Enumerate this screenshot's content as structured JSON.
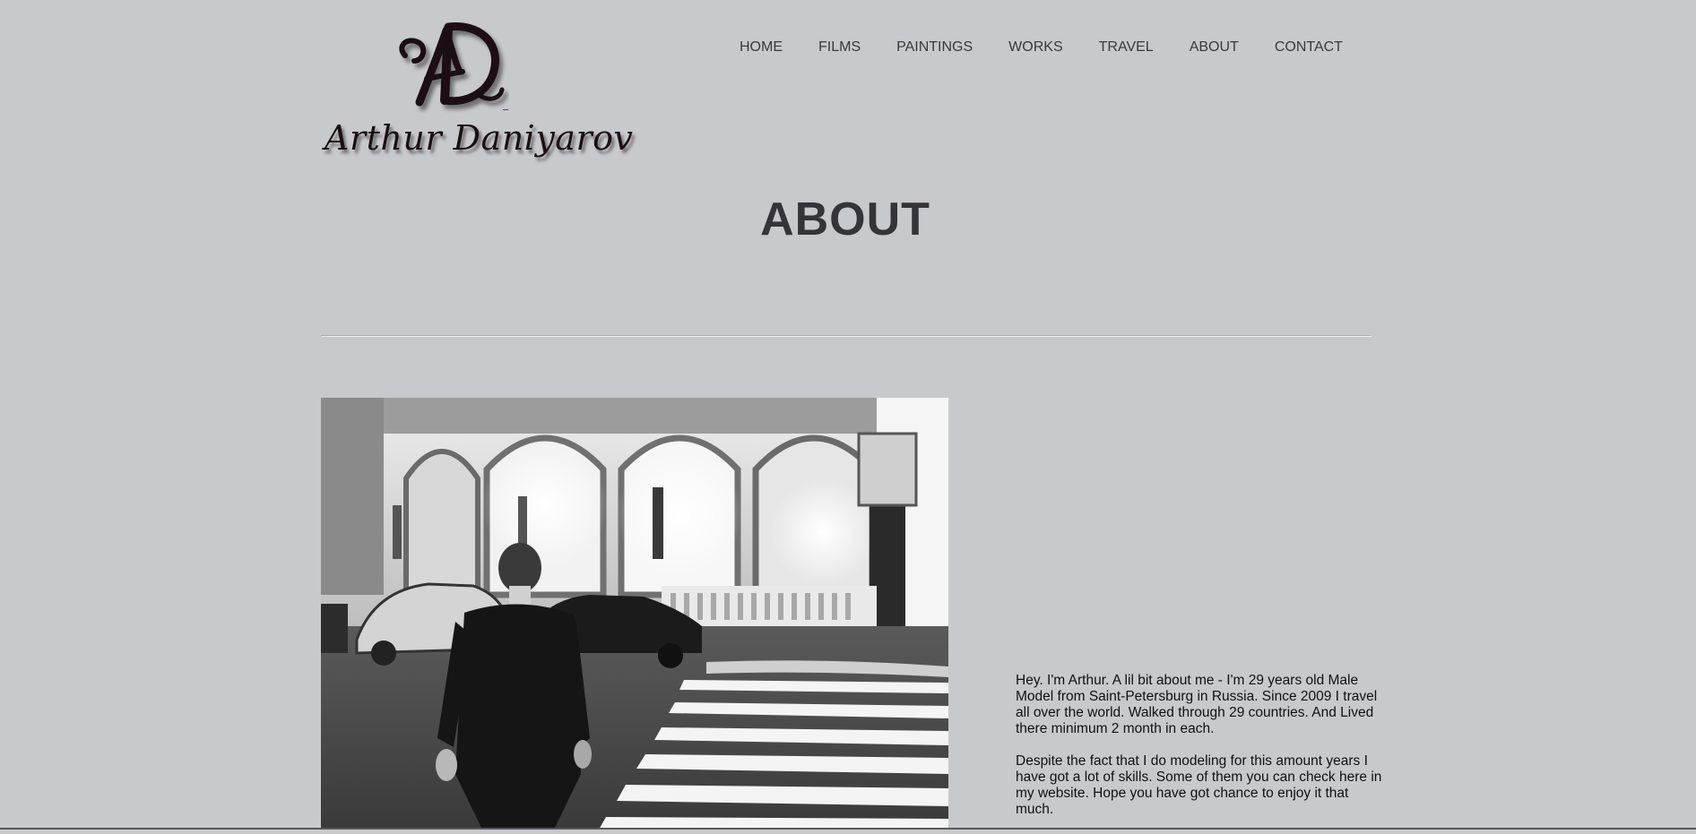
{
  "site": {
    "brand_name": "Arthur Daniyarov",
    "monogram": "AD"
  },
  "nav": {
    "items": [
      {
        "label": "HOME"
      },
      {
        "label": "FILMS"
      },
      {
        "label": "PAINTINGS"
      },
      {
        "label": "WORKS"
      },
      {
        "label": "TRAVEL"
      },
      {
        "label": "ABOUT"
      },
      {
        "label": "CONTACT"
      }
    ]
  },
  "page": {
    "title": "ABOUT"
  },
  "bio": {
    "paragraphs": [
      "Hey. I'm Arthur. A lil bit about me - I'm 29 years old Male Model from Saint-Petersburg in Russia. Since 2009 I travel all over the world. Walked through 29 countries. And Lived there minimum 2 month in each.",
      "Despite the fact that I do modeling for this amount years I have got a lot of skills. Some of them you can check here in my website. Hope you have got chance to enjoy it that much."
    ]
  },
  "colors": {
    "background": "#c8c9cd",
    "nav_text": "#3a3a3a",
    "title_text": "#34343a",
    "logo_ink": "#1a0f12"
  },
  "photo": {
    "icon": "street-photo",
    "style": "black-and-white"
  }
}
